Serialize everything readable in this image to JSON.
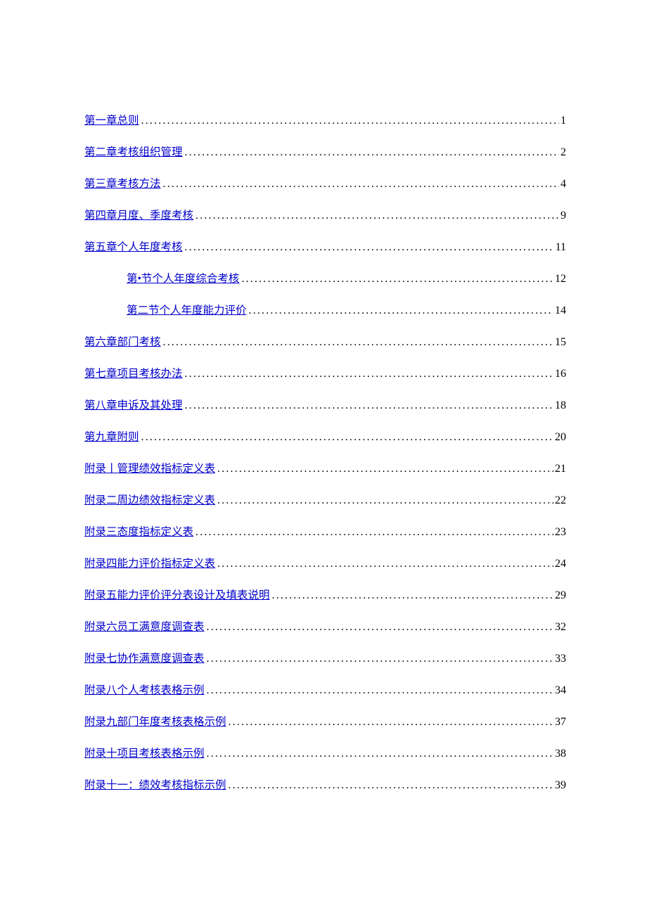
{
  "toc": [
    {
      "label": "第一章总则",
      "page": "1",
      "indent": false
    },
    {
      "label": "第二章考核组织管理",
      "page": "2",
      "indent": false
    },
    {
      "label": "第三章考核方法",
      "page": "4",
      "indent": false
    },
    {
      "label": "第四章月度、季度考核",
      "page": "9",
      "indent": false
    },
    {
      "label": "第五章个人年度考核",
      "page": "11",
      "indent": false
    },
    {
      "label": "第•节个人年度综合考核",
      "page": "12",
      "indent": true
    },
    {
      "label": "第二节个人年度能力评价",
      "page": "14",
      "indent": true
    },
    {
      "label": "第六章部门考核",
      "page": "15",
      "indent": false
    },
    {
      "label": "第七章项目考核办法",
      "page": "16",
      "indent": false
    },
    {
      "label": "第八章申诉及其处理",
      "page": "18",
      "indent": false
    },
    {
      "label": "第九章附则",
      "page": "20",
      "indent": false
    },
    {
      "label": "附录丨管理绩效指标定义表",
      "page": "21",
      "indent": false
    },
    {
      "label": "附录二周边绩效指标定义表",
      "page": "22",
      "indent": false
    },
    {
      "label": "附录三态度指标定义表",
      "page": "23",
      "indent": false
    },
    {
      "label": "附录四能力评价指标定义表",
      "page": "24",
      "indent": false
    },
    {
      "label": "附录五能力评价评分表设计及填表说明",
      "page": "29",
      "indent": false
    },
    {
      "label": "附录六员工满意度调查表",
      "page": "32",
      "indent": false
    },
    {
      "label": "附录七协作满意度调查表",
      "page": "33",
      "indent": false
    },
    {
      "label": "附录八个人考核表格示例",
      "page": "34",
      "indent": false
    },
    {
      "label": "附录九部门年度考核表格示例",
      "page": "37",
      "indent": false
    },
    {
      "label": "附录十项目考核表格示例",
      "page": "38",
      "indent": false
    },
    {
      "label": "附录十一：绩效考核指标示例",
      "page": "39",
      "indent": false
    }
  ]
}
